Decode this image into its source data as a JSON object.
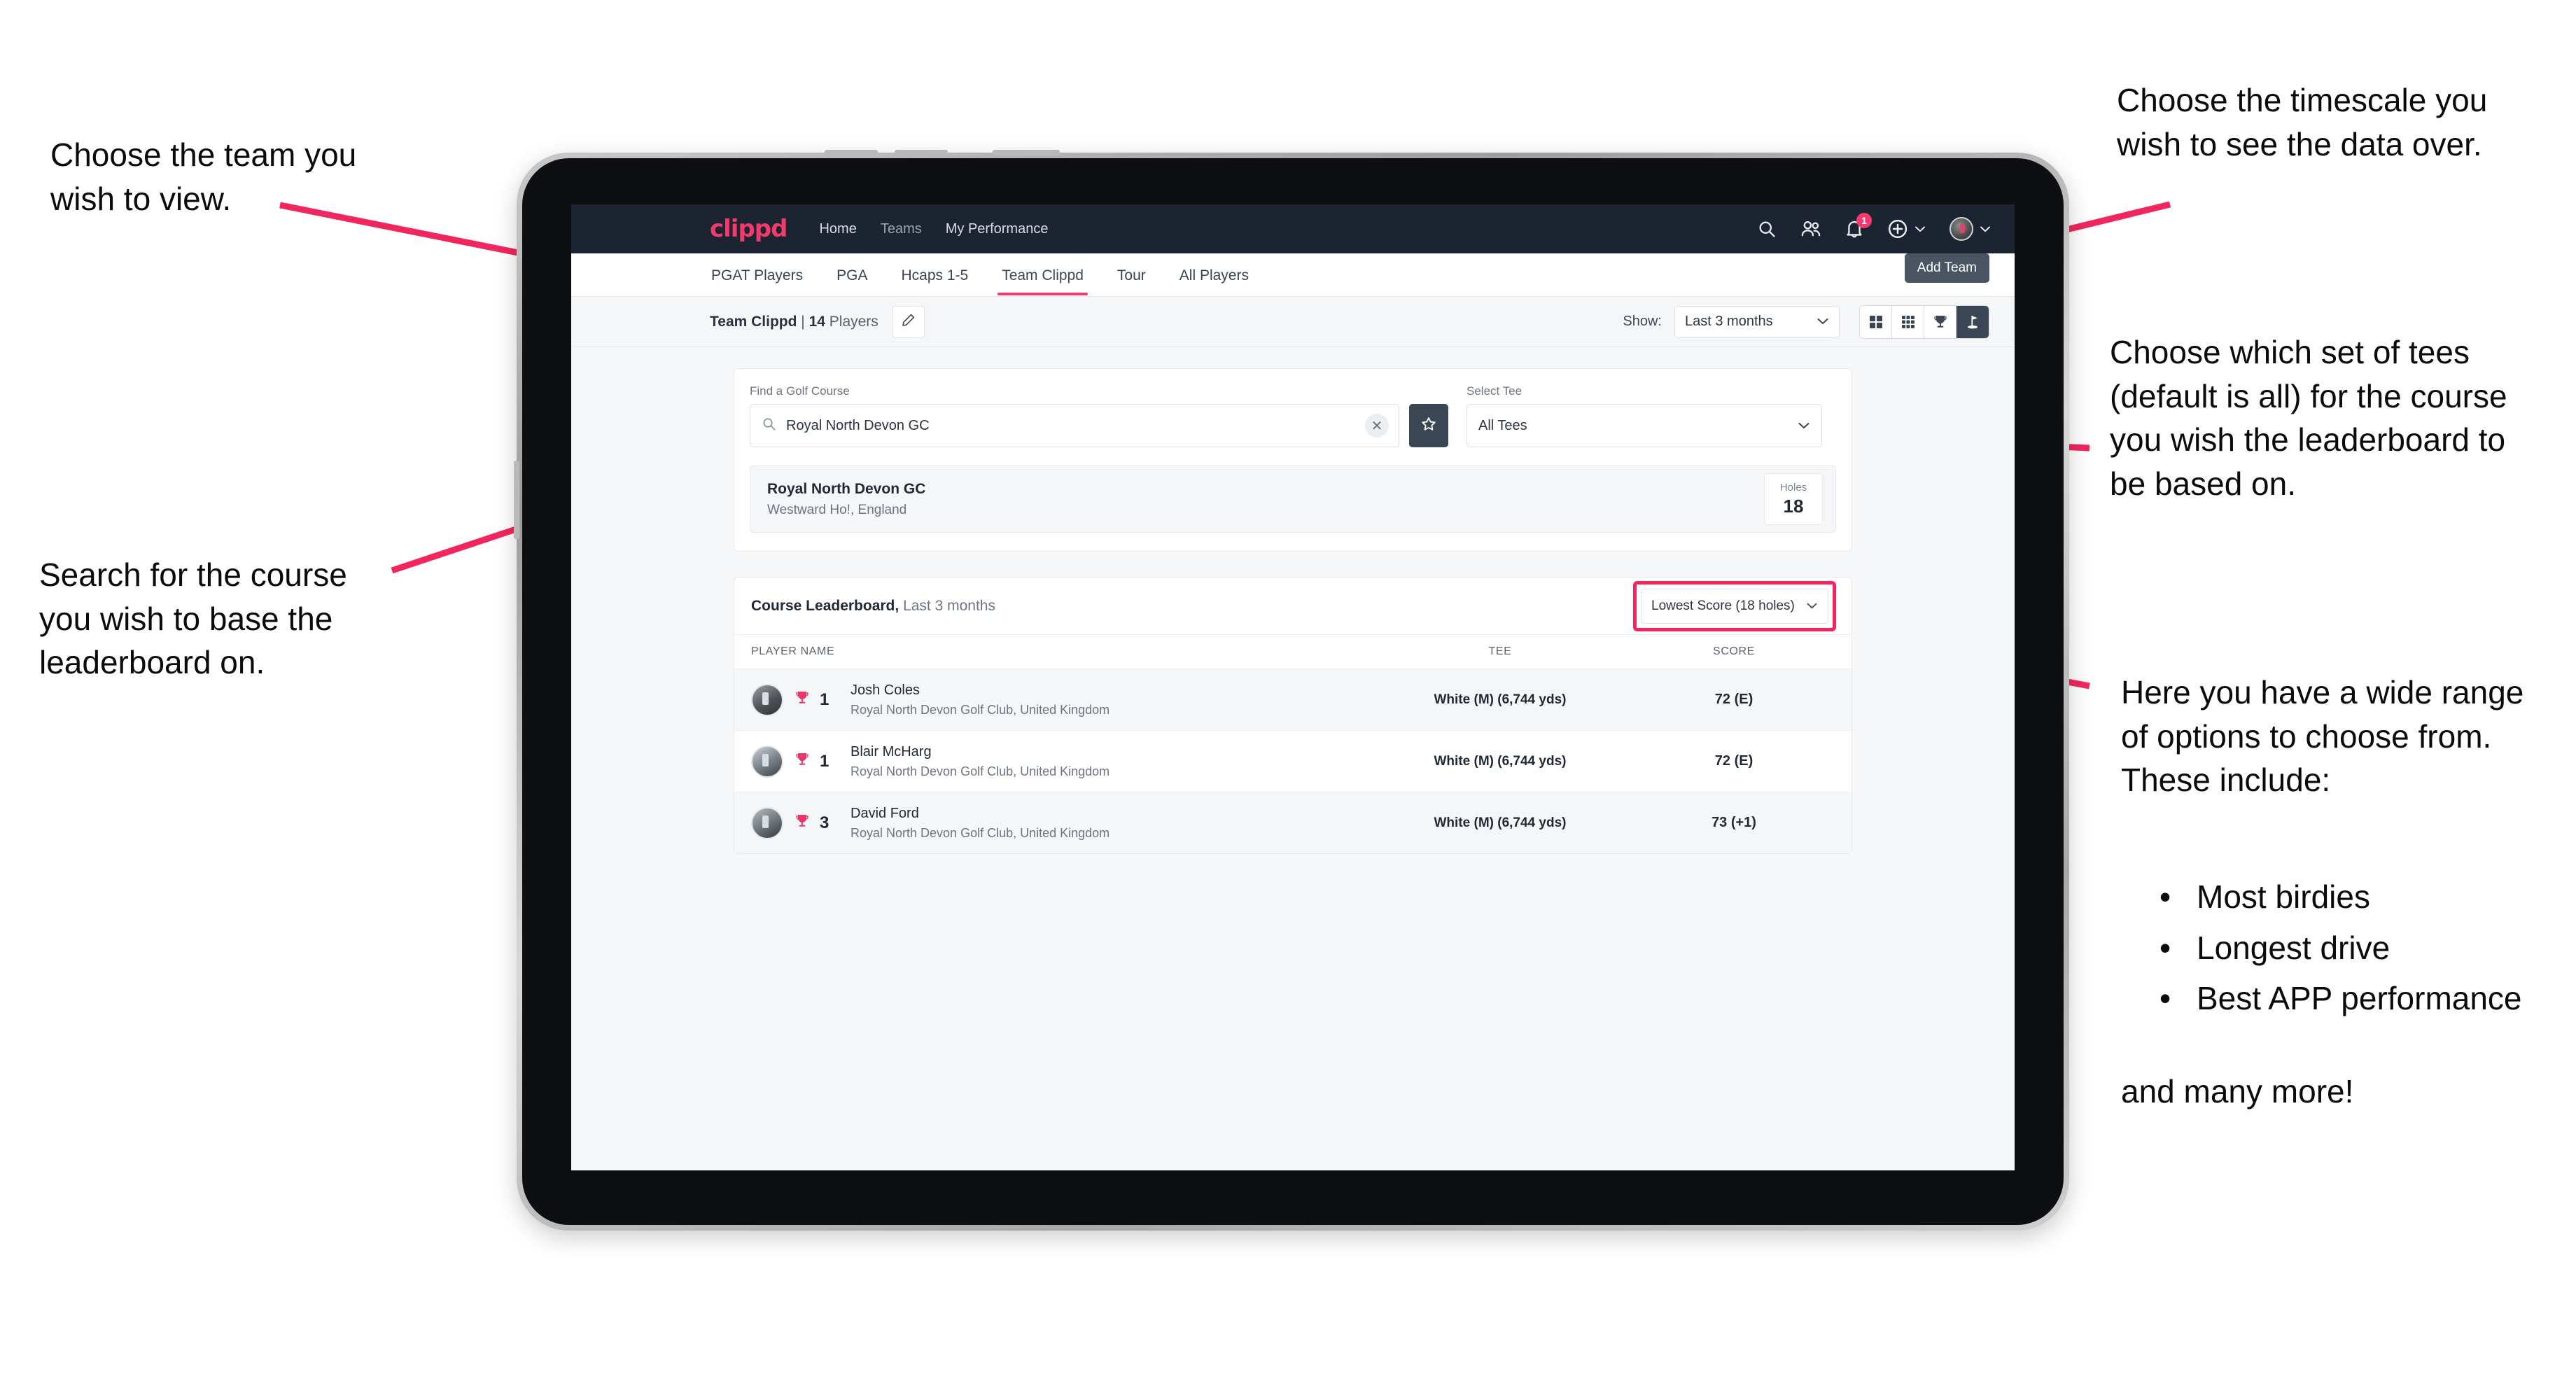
{
  "annotations": {
    "team": "Choose the team you\nwish to view.",
    "timescale": "Choose the timescale you\nwish to see the data over.",
    "tees": "Choose which set of tees\n(default is all) for the course\nyou wish the leaderboard to\nbe based on.",
    "search": "Search for the course\nyou wish to base the\nleaderboard on.",
    "options_intro": "Here you have a wide range\nof options to choose from.\nThese include:",
    "options_bullets": [
      "Most birdies",
      "Longest drive",
      "Best APP performance"
    ],
    "options_outro": "and many more!",
    "arrow_color": "#f2265f"
  },
  "app": {
    "brand": "clippd",
    "nav_links": [
      {
        "label": "Home",
        "active": true
      },
      {
        "label": "Teams",
        "active": false
      },
      {
        "label": "My Performance",
        "active": true
      }
    ],
    "nav_icons": [
      {
        "name": "search-icon"
      },
      {
        "name": "people-icon"
      },
      {
        "name": "bell-icon",
        "badge": "1"
      },
      {
        "name": "plus-circle-icon"
      },
      {
        "name": "user-avatar"
      }
    ],
    "tabs": [
      {
        "label": "PGAT Players",
        "active": false
      },
      {
        "label": "PGA",
        "active": false
      },
      {
        "label": "Hcaps 1-5",
        "active": false
      },
      {
        "label": "Team Clippd",
        "active": true
      },
      {
        "label": "Tour",
        "active": false
      },
      {
        "label": "All Players",
        "active": false
      }
    ],
    "toolbar": {
      "team_name": "Team Clippd",
      "separator": " | ",
      "player_count": "14",
      "players_word": " Players",
      "edit_icon": "pencil-icon",
      "show_label": "Show:",
      "show_value": "Last 3 months",
      "tooltip": "Add Team",
      "view_toggles": [
        {
          "name": "grid-2x2-icon",
          "active": false
        },
        {
          "name": "grid-3x3-icon",
          "active": false
        },
        {
          "name": "trophy-icon",
          "active": false
        },
        {
          "name": "golf-flag-icon",
          "active": true
        }
      ]
    },
    "search_panel": {
      "course_label": "Find a Golf Course",
      "course_value": "Royal North Devon GC",
      "course_placeholder": "Find a Golf Course",
      "clear_icon": "close-icon",
      "star_icon": "star-icon",
      "tee_label": "Select Tee",
      "tee_value": "All Tees"
    },
    "course_result": {
      "name": "Royal North Devon GC",
      "location": "Westward Ho!, England",
      "holes_label": "Holes",
      "holes_value": "18"
    },
    "leaderboard": {
      "title": "Course Leaderboard,",
      "subtitle": " Last 3 months",
      "sort_value": "Lowest Score (18 holes)",
      "columns": [
        "PLAYER NAME",
        "TEE",
        "SCORE"
      ],
      "rows": [
        {
          "rank": "1",
          "player": "Josh Coles",
          "club": "Royal North Devon Golf Club, United Kingdom",
          "tee": "White (M) (6,744 yds)",
          "score": "72 (E)"
        },
        {
          "rank": "1",
          "player": "Blair McHarg",
          "club": "Royal North Devon Golf Club, United Kingdom",
          "tee": "White (M) (6,744 yds)",
          "score": "72 (E)"
        },
        {
          "rank": "3",
          "player": "David Ford",
          "club": "Royal North Devon Golf Club, United Kingdom",
          "tee": "White (M) (6,744 yds)",
          "score": "73 (+1)"
        }
      ]
    }
  },
  "colors": {
    "accent": "#f23b6c",
    "navbar": "#1b2430",
    "dark_control": "#3b4654",
    "highlight": "#f2265f"
  }
}
